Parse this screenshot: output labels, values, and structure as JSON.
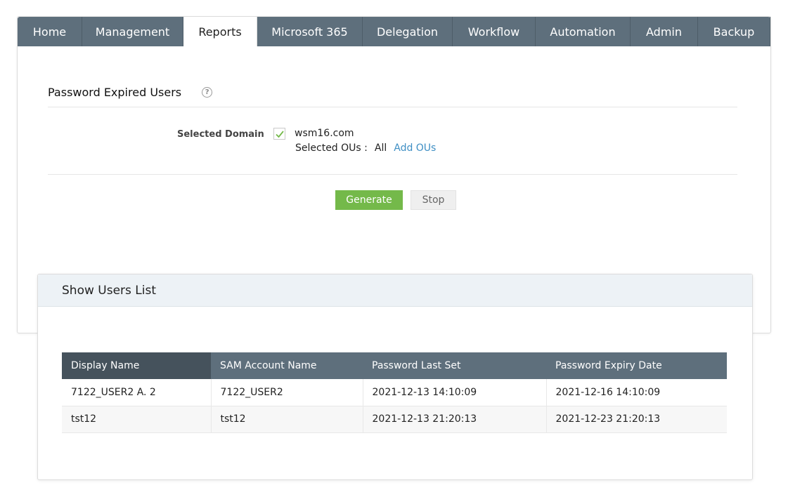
{
  "nav": {
    "tabs": [
      {
        "label": "Home",
        "active": false
      },
      {
        "label": "Management",
        "active": false
      },
      {
        "label": "Reports",
        "active": true
      },
      {
        "label": "Microsoft 365",
        "active": false
      },
      {
        "label": "Delegation",
        "active": false
      },
      {
        "label": "Workflow",
        "active": false
      },
      {
        "label": "Automation",
        "active": false
      },
      {
        "label": "Admin",
        "active": false
      },
      {
        "label": "Backup",
        "active": false
      }
    ]
  },
  "report": {
    "title": "Password Expired Users",
    "help_icon": "?",
    "domain_label": "Selected Domain",
    "domain_checked": true,
    "domain_name": "wsm16.com",
    "ous_label": "Selected OUs :",
    "ous_value": "All",
    "add_ous_link": "Add OUs",
    "generate_label": "Generate",
    "stop_label": "Stop"
  },
  "users_list": {
    "title": "Show Users List",
    "columns": [
      "Display Name",
      "SAM Account Name",
      "Password Last Set",
      "Password Expiry Date"
    ],
    "rows": [
      [
        "7122_USER2 A. 2",
        "7122_USER2",
        "2021-12-13 14:10:09",
        "2021-12-16 14:10:09"
      ],
      [
        "tst12",
        "tst12",
        "2021-12-13 21:20:13",
        "2021-12-23 21:20:13"
      ]
    ]
  },
  "colors": {
    "tabbar": "#5e6f7c",
    "generate_button": "#74b94a",
    "link": "#3f8fc4",
    "check": "#74b94a"
  }
}
